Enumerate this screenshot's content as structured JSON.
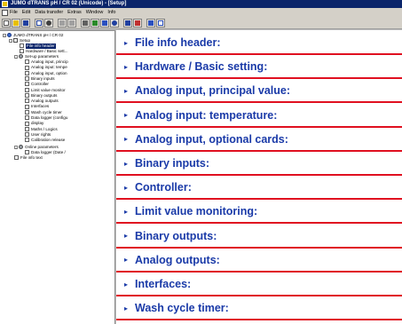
{
  "window": {
    "title": "JUMO dTRANS pH / CR 02 (Unicode) - [Setup]"
  },
  "menubar": {
    "items": [
      "File",
      "Edit",
      "Data transfer",
      "Extras",
      "Window",
      "Info"
    ]
  },
  "toolbar": {
    "buttons": [
      "new",
      "open",
      "save",
      "print-preview",
      "binoculars",
      "back",
      "forward",
      "tools",
      "transfer-to",
      "transfer-from",
      "connect",
      "disconnect",
      "options",
      "info",
      "help"
    ]
  },
  "tree": {
    "root": "JUMO dTRANS pH / CR 02",
    "setup": "Setup",
    "file_info_header": "File info header",
    "hardware": "Hardware / Basic sett...",
    "setup_parameters": "Set-up parameters",
    "setup_children": [
      "Analog input, princip",
      "Analog input: tempe",
      "Analog input, option",
      "Binary inputs",
      "Controller",
      "Limit value monitor",
      "Binary outputs",
      "Analog outputs",
      "Interfaces",
      "Wash cycle timer",
      "Data logger (configu",
      "display",
      "Maths / Logics",
      "User rights",
      "Calibration release"
    ],
    "online_parameters": "Online parameters",
    "data_logger_date": "Data logger (Date /",
    "file_info_text": "File info text"
  },
  "sections": [
    "File info header:",
    "Hardware / Basic setting:",
    "Analog input, principal value:",
    "Analog input: temperature:",
    "Analog input, optional cards:",
    "Binary inputs:",
    "Controller:",
    "Limit value monitoring:",
    "Binary outputs:",
    "Analog outputs:",
    "Interfaces:",
    "Wash cycle timer:"
  ],
  "colors": {
    "accent_blue": "#1a3aa8",
    "rule_red": "#e01020",
    "titlebar": "#0a246a"
  }
}
